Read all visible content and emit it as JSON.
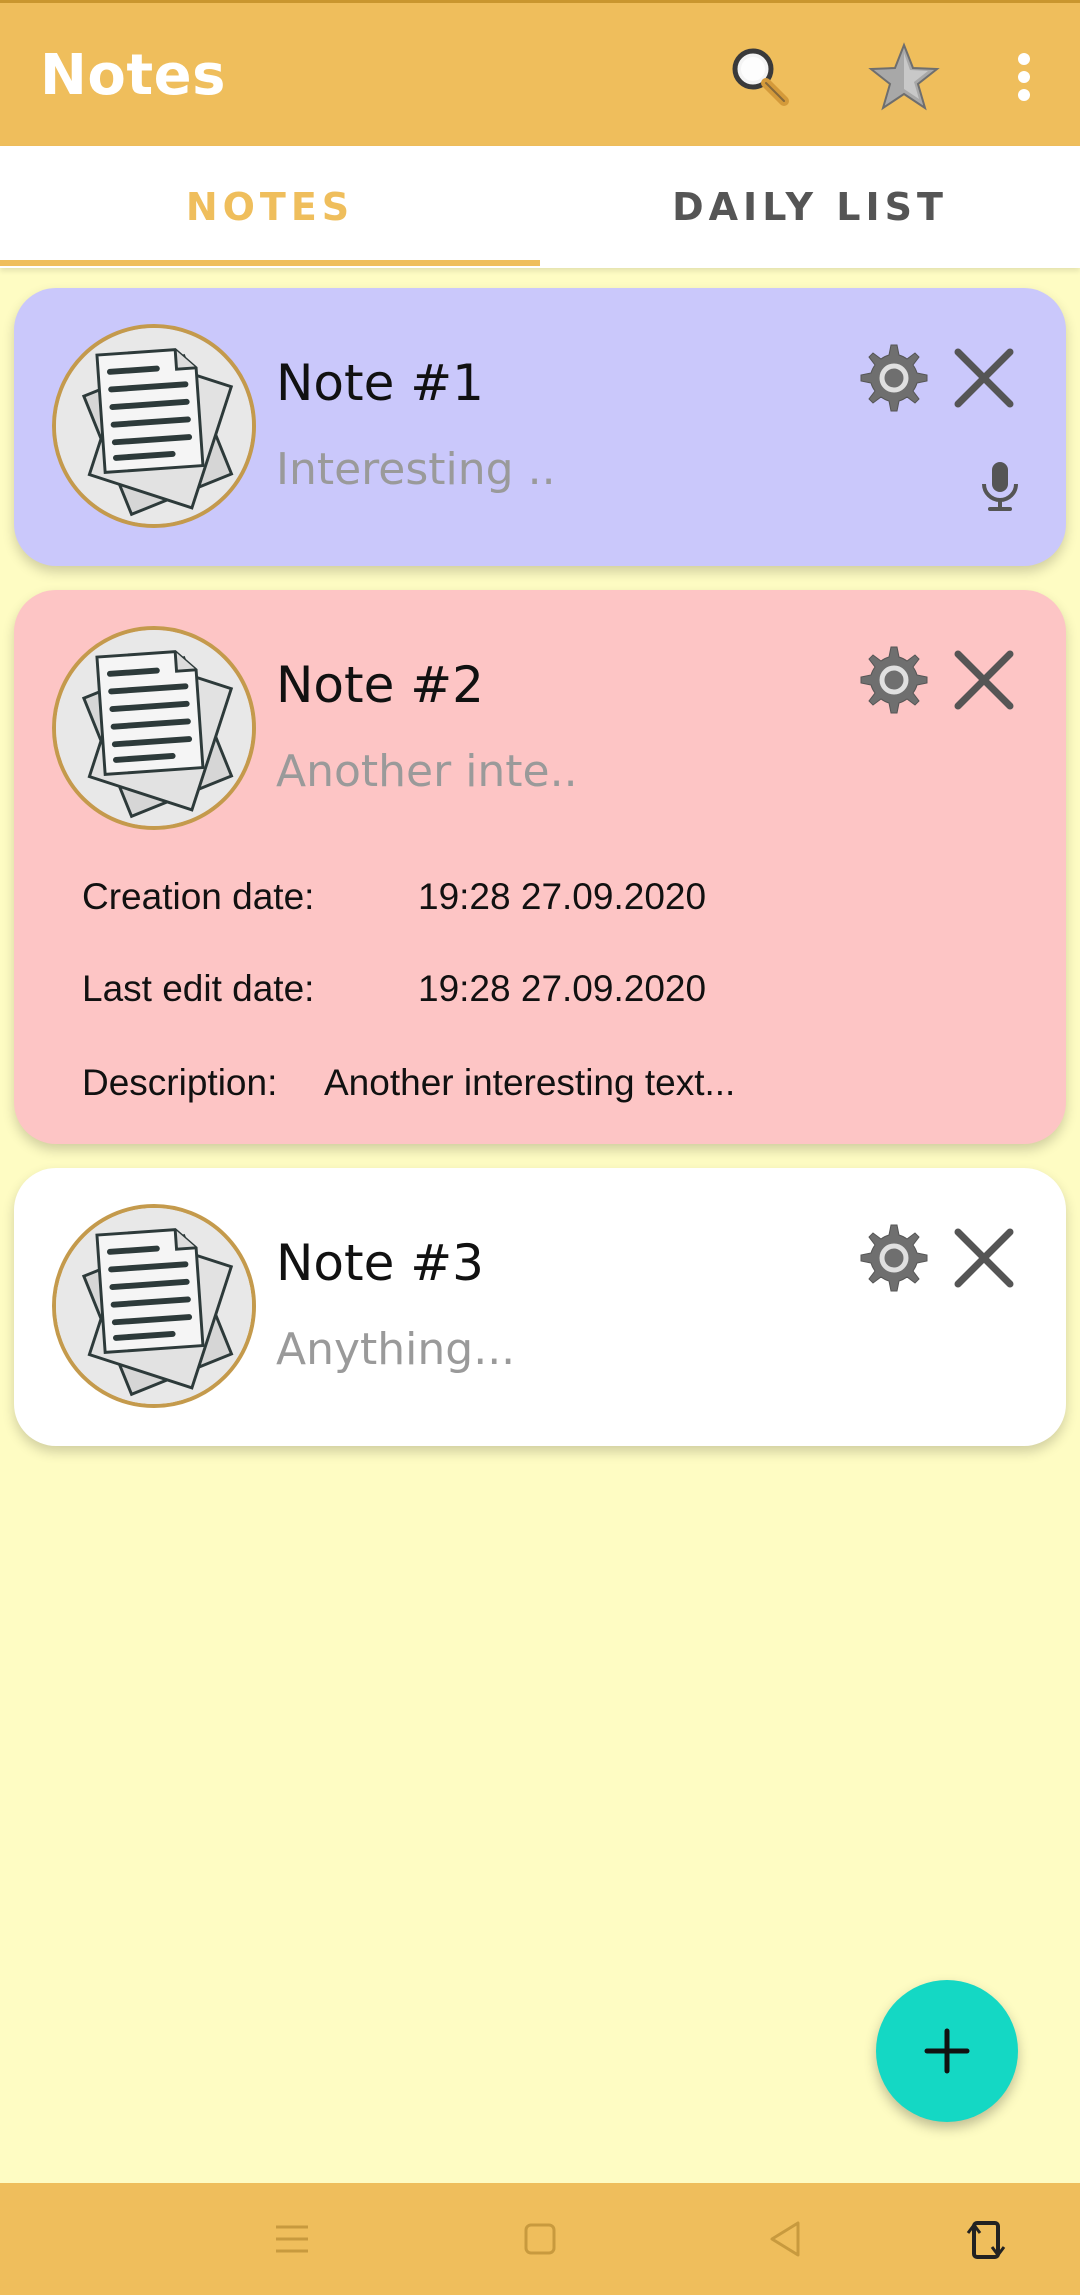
{
  "appbar": {
    "title": "Notes",
    "icons": [
      "search-icon",
      "star-icon",
      "more-vert-icon"
    ]
  },
  "tabs": [
    {
      "label": "NOTES",
      "selected": true
    },
    {
      "label": "DAILY LIST",
      "selected": false
    }
  ],
  "notes": [
    {
      "title": "Note #1",
      "preview": "Interesting ..",
      "color": "#cac8fb",
      "has_voice": true,
      "expanded": false
    },
    {
      "title": "Note #2",
      "preview": "Another inte..",
      "color": "#fdc5c5",
      "has_voice": false,
      "expanded": true,
      "details": {
        "creation_label": "Creation date:",
        "creation_value": "19:28 27.09.2020",
        "edit_label": "Last edit date:",
        "edit_value": "19:28 27.09.2020",
        "description_label": "Description:",
        "description_value": "Another interesting text..."
      }
    },
    {
      "title": "Note #3",
      "preview": "Anything...",
      "color": "#ffffff",
      "has_voice": false,
      "expanded": false
    }
  ],
  "fab": {
    "icon": "plus-icon"
  },
  "navbar": {
    "icons": [
      "menu-icon",
      "home-icon",
      "back-icon",
      "rotate-icon"
    ]
  },
  "colors": {
    "accent": "#efbe5c",
    "background": "#fefcc3",
    "fab": "#14d8c4",
    "tab_inactive": "#555555"
  }
}
